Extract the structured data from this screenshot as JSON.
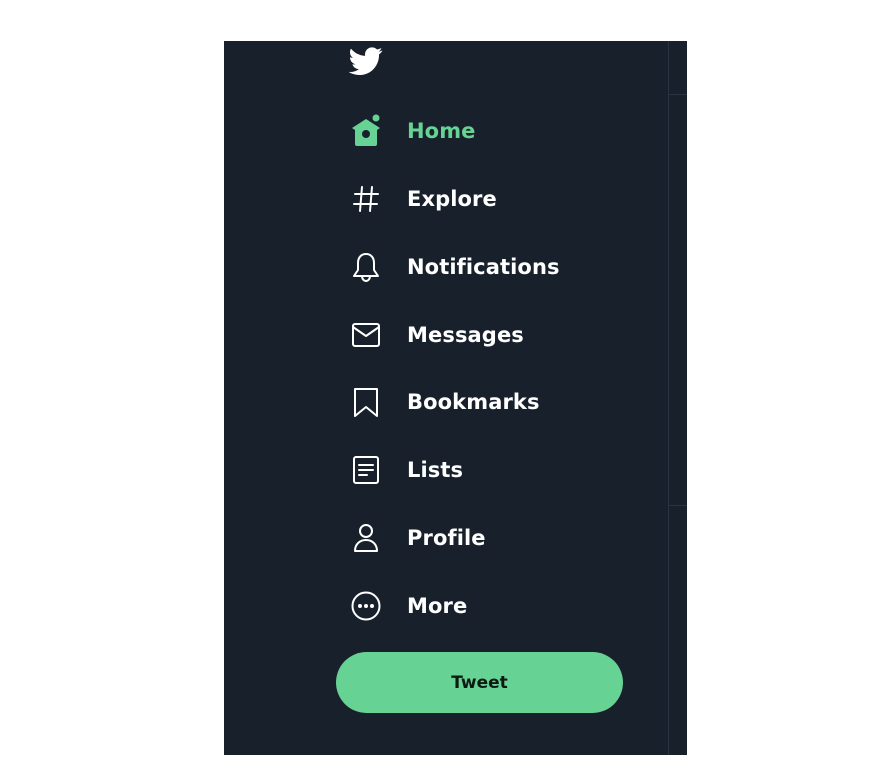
{
  "colors": {
    "panel_background": "#18212b",
    "accent": "#66d395",
    "text": "#ffffff"
  },
  "logo": {
    "icon": "bird-logo-icon"
  },
  "nav": {
    "items": [
      {
        "label": "Home",
        "icon": "home-icon",
        "active": true
      },
      {
        "label": "Explore",
        "icon": "hashtag-icon",
        "active": false
      },
      {
        "label": "Notifications",
        "icon": "bell-icon",
        "active": false
      },
      {
        "label": "Messages",
        "icon": "envelope-icon",
        "active": false
      },
      {
        "label": "Bookmarks",
        "icon": "bookmark-icon",
        "active": false
      },
      {
        "label": "Lists",
        "icon": "list-icon",
        "active": false
      },
      {
        "label": "Profile",
        "icon": "person-icon",
        "active": false
      },
      {
        "label": "More",
        "icon": "more-dots-icon",
        "active": false
      }
    ]
  },
  "tweet_button": {
    "label": "Tweet"
  }
}
